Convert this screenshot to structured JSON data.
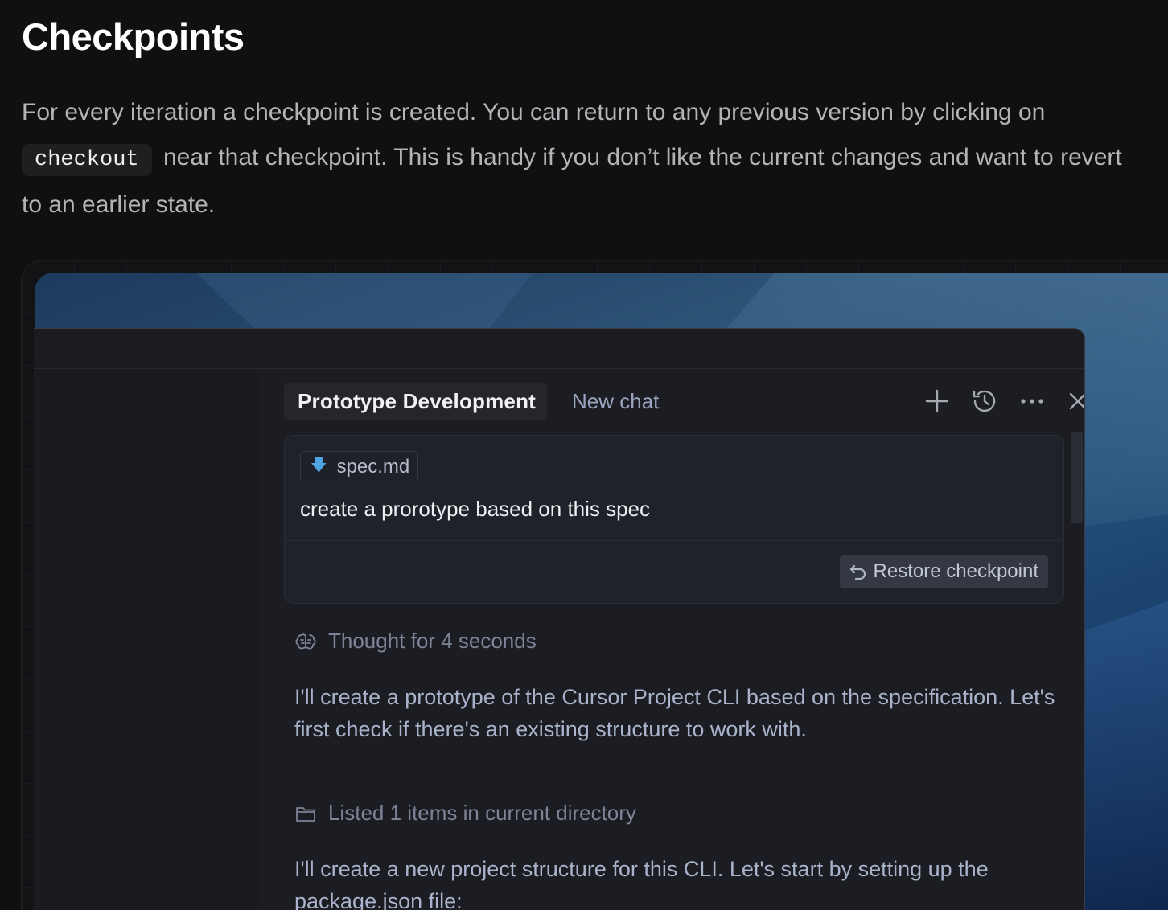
{
  "page": {
    "title": "Checkpoints",
    "intro_before": "For every iteration a checkpoint is created. You can return to any previous version by clicking on ",
    "intro_code": "checkout",
    "intro_after": " near that checkpoint. This is handy if you don’t like the current changes and want to revert to an earlier state."
  },
  "chat": {
    "tabs": [
      {
        "label": "Prototype Development",
        "active": true
      },
      {
        "label": "New chat",
        "active": false
      }
    ],
    "header_icons": [
      "plus-icon",
      "history-icon",
      "more-icon",
      "close-icon"
    ],
    "user_message": {
      "attachment": "spec.md",
      "attachment_icon": "arrow-down-icon",
      "text": "create a prorotype based on this spec",
      "restore_label": "Restore checkpoint",
      "restore_icon": "undo-icon"
    },
    "thought": {
      "icon": "brain-icon",
      "text": "Thought for 4 seconds"
    },
    "response_1": "I'll create a prototype of the Cursor Project CLI based on the specification. Let's first check if there's an existing structure to work with.",
    "listed": {
      "icon": "folder-icon",
      "text": "Listed 1 items in current directory"
    },
    "response_2": "I'll create a new project structure for this CLI. Let's start by setting up the package.json file:"
  },
  "colors": {
    "page_bg": "#101011",
    "panel_bg": "#1c1d22",
    "accent_blue": "#4fa3e0",
    "wallpaper": "#24507a"
  }
}
